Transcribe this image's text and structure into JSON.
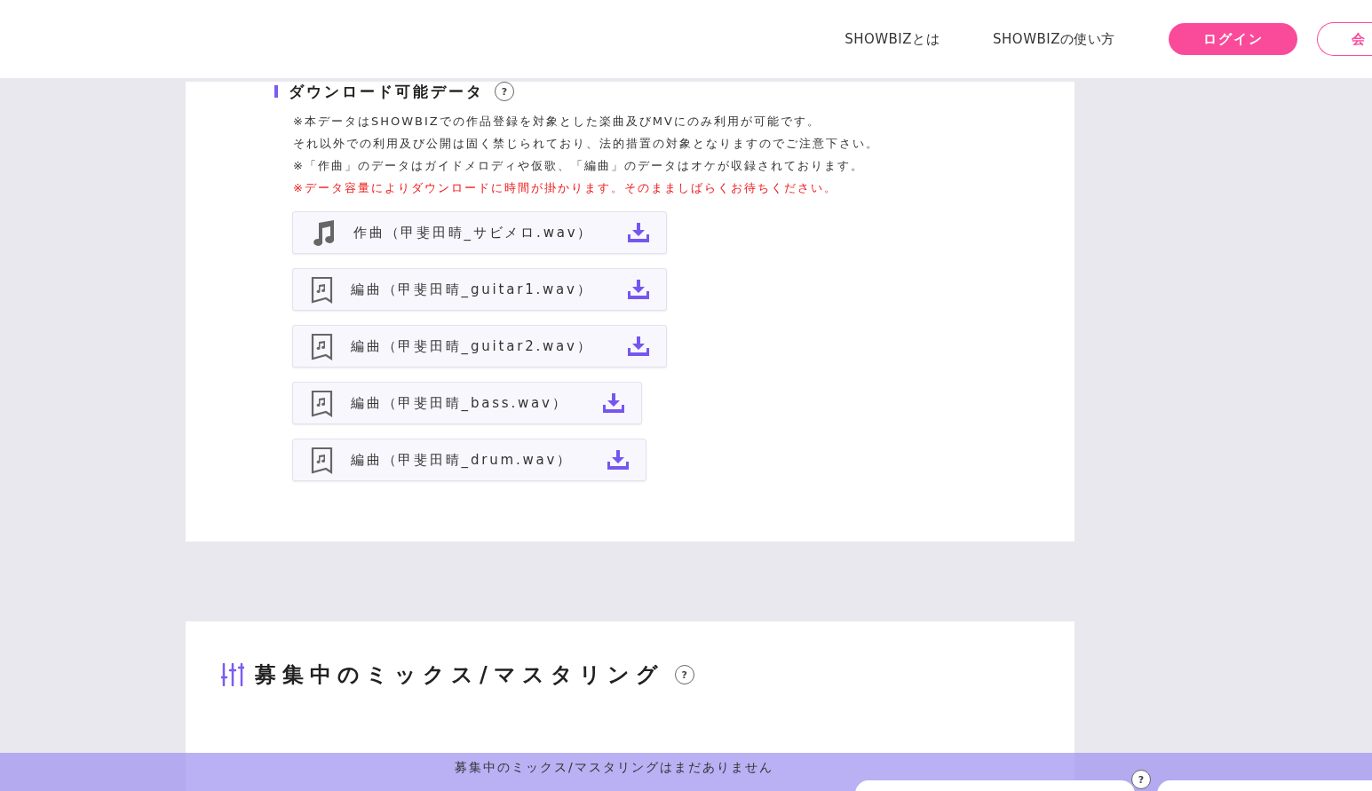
{
  "header": {
    "nav": [
      {
        "label": "SHOWBIZとは"
      },
      {
        "label": "SHOWBIZの使い方"
      }
    ],
    "login_button": "ログイン",
    "register_button": "会"
  },
  "download_section": {
    "title": "ダウンロード可能データ",
    "help": "?",
    "notes": [
      {
        "text": "※本データはSHOWBIZでの作品登録を対象とした楽曲及びMVにのみ利用が可能です。",
        "kind": "normal"
      },
      {
        "text": "それ以外での利用及び公開は固く禁じられており、法的措置の対象となりますのでご注意下さい。",
        "kind": "normal"
      },
      {
        "text": "※「作曲」のデータはガイドメロディや仮歌、「編曲」のデータはオケが収録されております。",
        "kind": "normal"
      },
      {
        "text": "※データ容量によりダウンロードに時間が掛かります。そのまましばらくお待ちください。",
        "kind": "warning"
      }
    ],
    "files": [
      {
        "label": "作曲（甲斐田晴_サビメロ.wav）",
        "kind": "composition"
      },
      {
        "label": "編曲（甲斐田晴_guitar1.wav）",
        "kind": "arrangement"
      },
      {
        "label": "編曲（甲斐田晴_guitar2.wav）",
        "kind": "arrangement"
      },
      {
        "label": "編曲（甲斐田晴_bass.wav）",
        "kind": "arrangement"
      },
      {
        "label": "編曲（甲斐田晴_drum.wav）",
        "kind": "arrangement"
      }
    ]
  },
  "mix_section": {
    "title": "募集中のミックス/マスタリング",
    "help": "?"
  },
  "bottom_bar": {
    "message": "募集中のミックス/マスタリングはまだありません",
    "help": "?"
  }
}
